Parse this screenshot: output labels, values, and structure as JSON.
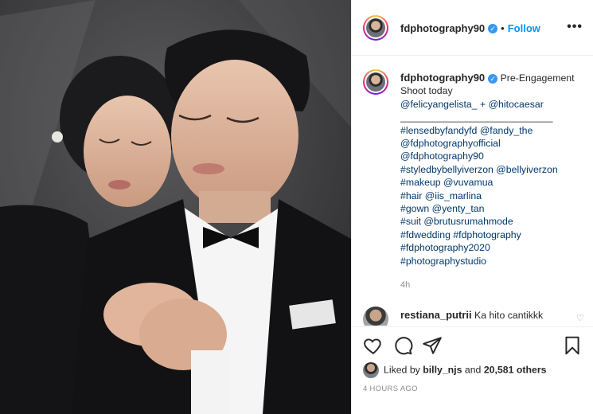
{
  "post": {
    "username": "fdphotography90",
    "follow_label": "Follow",
    "more_label": "•••"
  },
  "caption": {
    "username": "fdphotography90",
    "first_line_text": "Pre-Engagement",
    "lines": [
      "Shoot today",
      "@felicyangelista_ + @hitocaesar",
      "____________________________",
      "#lensedbyfandyfd @fandy_the",
      "@fdphotographyofficial",
      "@fdphotography90",
      "#styledbybellyiverzon @bellyiverzon",
      "#makeup @vuvamua",
      "#hair @iis_marlina",
      "#gown @yenty_tan",
      "#suit @brutusrumahmode",
      "#fdwedding #fdphotography",
      "#fdphotography2020",
      "#photographystudio"
    ],
    "age": "4h"
  },
  "comment": {
    "username": "restiana_putrii",
    "text": "Ka hito cantikkk"
  },
  "likes": {
    "prefix": "Liked by",
    "user": "billy_njs",
    "conj": "and",
    "count": "20,581 others"
  },
  "timestamp": "4 HOURS AGO",
  "colors": {
    "accent": "#0095f6",
    "tag": "#00376b",
    "muted": "#8e8e8e"
  }
}
